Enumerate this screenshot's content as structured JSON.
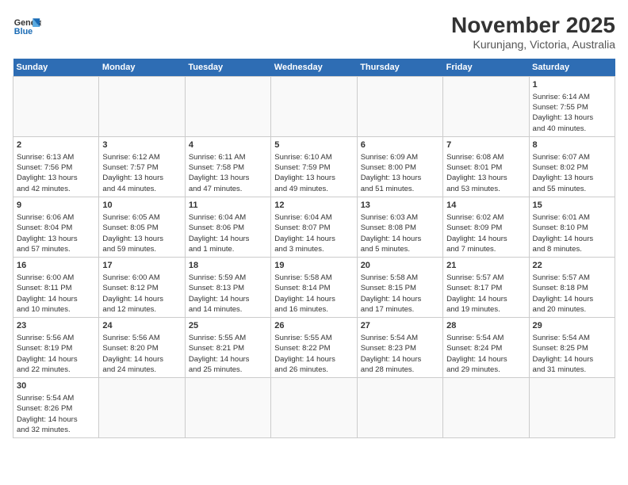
{
  "header": {
    "logo_line1": "General",
    "logo_line2": "Blue",
    "title": "November 2025",
    "subtitle": "Kurunjang, Victoria, Australia"
  },
  "weekdays": [
    "Sunday",
    "Monday",
    "Tuesday",
    "Wednesday",
    "Thursday",
    "Friday",
    "Saturday"
  ],
  "weeks": [
    [
      {
        "day": "",
        "info": ""
      },
      {
        "day": "",
        "info": ""
      },
      {
        "day": "",
        "info": ""
      },
      {
        "day": "",
        "info": ""
      },
      {
        "day": "",
        "info": ""
      },
      {
        "day": "",
        "info": ""
      },
      {
        "day": "1",
        "info": "Sunrise: 6:14 AM\nSunset: 7:55 PM\nDaylight: 13 hours\nand 40 minutes."
      }
    ],
    [
      {
        "day": "2",
        "info": "Sunrise: 6:13 AM\nSunset: 7:56 PM\nDaylight: 13 hours\nand 42 minutes."
      },
      {
        "day": "3",
        "info": "Sunrise: 6:12 AM\nSunset: 7:57 PM\nDaylight: 13 hours\nand 44 minutes."
      },
      {
        "day": "4",
        "info": "Sunrise: 6:11 AM\nSunset: 7:58 PM\nDaylight: 13 hours\nand 47 minutes."
      },
      {
        "day": "5",
        "info": "Sunrise: 6:10 AM\nSunset: 7:59 PM\nDaylight: 13 hours\nand 49 minutes."
      },
      {
        "day": "6",
        "info": "Sunrise: 6:09 AM\nSunset: 8:00 PM\nDaylight: 13 hours\nand 51 minutes."
      },
      {
        "day": "7",
        "info": "Sunrise: 6:08 AM\nSunset: 8:01 PM\nDaylight: 13 hours\nand 53 minutes."
      },
      {
        "day": "8",
        "info": "Sunrise: 6:07 AM\nSunset: 8:02 PM\nDaylight: 13 hours\nand 55 minutes."
      }
    ],
    [
      {
        "day": "9",
        "info": "Sunrise: 6:06 AM\nSunset: 8:04 PM\nDaylight: 13 hours\nand 57 minutes."
      },
      {
        "day": "10",
        "info": "Sunrise: 6:05 AM\nSunset: 8:05 PM\nDaylight: 13 hours\nand 59 minutes."
      },
      {
        "day": "11",
        "info": "Sunrise: 6:04 AM\nSunset: 8:06 PM\nDaylight: 14 hours\nand 1 minute."
      },
      {
        "day": "12",
        "info": "Sunrise: 6:04 AM\nSunset: 8:07 PM\nDaylight: 14 hours\nand 3 minutes."
      },
      {
        "day": "13",
        "info": "Sunrise: 6:03 AM\nSunset: 8:08 PM\nDaylight: 14 hours\nand 5 minutes."
      },
      {
        "day": "14",
        "info": "Sunrise: 6:02 AM\nSunset: 8:09 PM\nDaylight: 14 hours\nand 7 minutes."
      },
      {
        "day": "15",
        "info": "Sunrise: 6:01 AM\nSunset: 8:10 PM\nDaylight: 14 hours\nand 8 minutes."
      }
    ],
    [
      {
        "day": "16",
        "info": "Sunrise: 6:00 AM\nSunset: 8:11 PM\nDaylight: 14 hours\nand 10 minutes."
      },
      {
        "day": "17",
        "info": "Sunrise: 6:00 AM\nSunset: 8:12 PM\nDaylight: 14 hours\nand 12 minutes."
      },
      {
        "day": "18",
        "info": "Sunrise: 5:59 AM\nSunset: 8:13 PM\nDaylight: 14 hours\nand 14 minutes."
      },
      {
        "day": "19",
        "info": "Sunrise: 5:58 AM\nSunset: 8:14 PM\nDaylight: 14 hours\nand 16 minutes."
      },
      {
        "day": "20",
        "info": "Sunrise: 5:58 AM\nSunset: 8:15 PM\nDaylight: 14 hours\nand 17 minutes."
      },
      {
        "day": "21",
        "info": "Sunrise: 5:57 AM\nSunset: 8:17 PM\nDaylight: 14 hours\nand 19 minutes."
      },
      {
        "day": "22",
        "info": "Sunrise: 5:57 AM\nSunset: 8:18 PM\nDaylight: 14 hours\nand 20 minutes."
      }
    ],
    [
      {
        "day": "23",
        "info": "Sunrise: 5:56 AM\nSunset: 8:19 PM\nDaylight: 14 hours\nand 22 minutes."
      },
      {
        "day": "24",
        "info": "Sunrise: 5:56 AM\nSunset: 8:20 PM\nDaylight: 14 hours\nand 24 minutes."
      },
      {
        "day": "25",
        "info": "Sunrise: 5:55 AM\nSunset: 8:21 PM\nDaylight: 14 hours\nand 25 minutes."
      },
      {
        "day": "26",
        "info": "Sunrise: 5:55 AM\nSunset: 8:22 PM\nDaylight: 14 hours\nand 26 minutes."
      },
      {
        "day": "27",
        "info": "Sunrise: 5:54 AM\nSunset: 8:23 PM\nDaylight: 14 hours\nand 28 minutes."
      },
      {
        "day": "28",
        "info": "Sunrise: 5:54 AM\nSunset: 8:24 PM\nDaylight: 14 hours\nand 29 minutes."
      },
      {
        "day": "29",
        "info": "Sunrise: 5:54 AM\nSunset: 8:25 PM\nDaylight: 14 hours\nand 31 minutes."
      }
    ],
    [
      {
        "day": "30",
        "info": "Sunrise: 5:54 AM\nSunset: 8:26 PM\nDaylight: 14 hours\nand 32 minutes."
      },
      {
        "day": "",
        "info": ""
      },
      {
        "day": "",
        "info": ""
      },
      {
        "day": "",
        "info": ""
      },
      {
        "day": "",
        "info": ""
      },
      {
        "day": "",
        "info": ""
      },
      {
        "day": "",
        "info": ""
      }
    ]
  ]
}
